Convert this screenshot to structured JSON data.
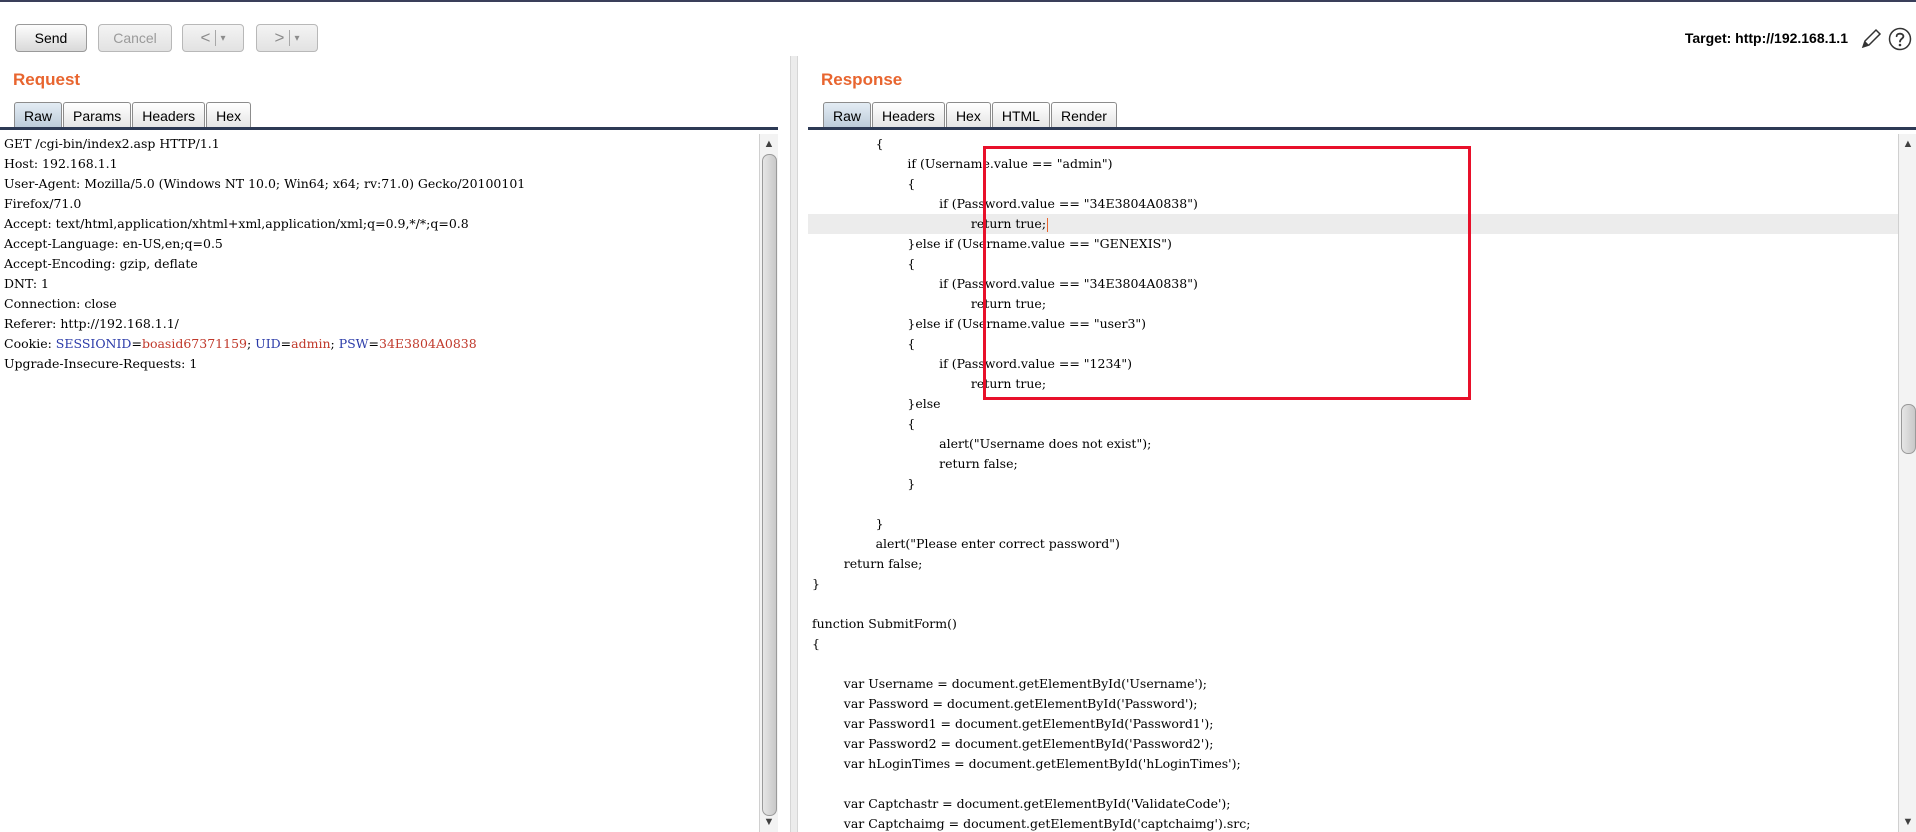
{
  "toolbar": {
    "send_label": "Send",
    "cancel_label": "Cancel",
    "back_glyph": "<",
    "forward_glyph": ">",
    "dropdown_glyph": "▾",
    "target_label": "Target: http://192.168.1.1",
    "edit_icon": "pencil-icon",
    "help_icon": "help-icon"
  },
  "request": {
    "title": "Request",
    "tabs": [
      "Raw",
      "Params",
      "Headers",
      "Hex"
    ],
    "active_tab": "Raw",
    "lines": [
      "GET /cgi-bin/index2.asp HTTP/1.1",
      "Host: 192.168.1.1",
      "User-Agent: Mozilla/5.0 (Windows NT 10.0; Win64; x64; rv:71.0) Gecko/20100101",
      "Firefox/71.0",
      "Accept: text/html,application/xhtml+xml,application/xml;q=0.9,*/*;q=0.8",
      "Accept-Language: en-US,en;q=0.5",
      "Accept-Encoding: gzip, deflate",
      "DNT: 1",
      "Connection: close",
      "Referer: http://192.168.1.1/"
    ],
    "cookie": {
      "prefix": "Cookie: ",
      "name1": "SESSIONID",
      "val1": "boasid67371159",
      "name2": "UID",
      "val2": "admin",
      "name3": "PSW",
      "val3": "34E3804A0838",
      "sep": "; ",
      "eq": "="
    },
    "last_line": "Upgrade-Insecure-Requests: 1"
  },
  "response": {
    "title": "Response",
    "tabs": [
      "Raw",
      "Headers",
      "Hex",
      "HTML",
      "Render"
    ],
    "active_tab": "Raw",
    "lines": [
      "                {",
      "                        if (Username.value == \"admin\")",
      "                        {",
      "                                if (Password.value == \"34E3804A0838\")",
      "                                        return true;",
      "                        }else if (Username.value == \"GENEXIS\")",
      "                        {",
      "                                if (Password.value == \"34E3804A0838\")",
      "                                        return true;",
      "                        }else if (Username.value == \"user3\")",
      "                        {",
      "                                if (Password.value == \"1234\")",
      "                                        return true;",
      "                        }else",
      "                        {",
      "                                alert(\"Username does not exist\");",
      "                                return false;",
      "                        }",
      "",
      "                }",
      "                alert(\"Please enter correct password\")",
      "        return false;",
      "}",
      "",
      "function SubmitForm()",
      "{",
      "",
      "        var Username = document.getElementById('Username');",
      "        var Password = document.getElementById('Password');",
      "        var Password1 = document.getElementById('Password1');",
      "        var Password2 = document.getElementById('Password2');",
      "        var hLoginTimes = document.getElementById('hLoginTimes');",
      "",
      "        var Captchastr = document.getElementById('ValidateCode');",
      "        var Captchaimg = document.getElementById('captchaimg').src;"
    ],
    "highlight_line_index": 4
  },
  "colors": {
    "accent_orange": "#e8652f",
    "cookie_name_blue": "#2a3aa8",
    "cookie_value_red": "#c0392b",
    "annotation_red": "#e8102a"
  }
}
